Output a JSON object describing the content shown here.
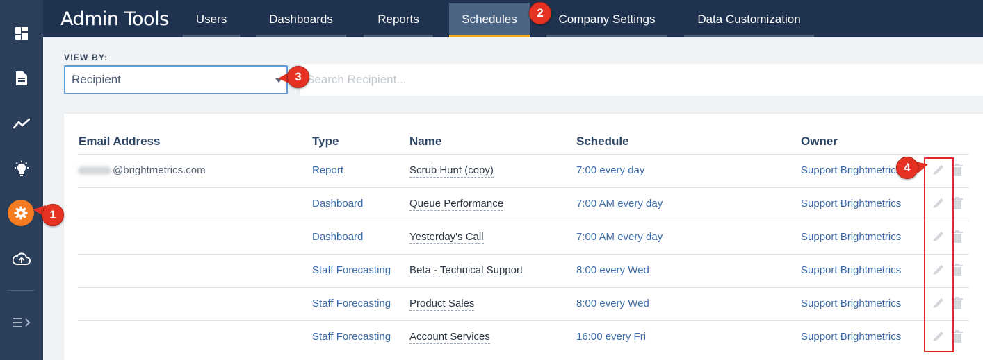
{
  "app_title": "Admin Tools",
  "tabs": [
    {
      "label": "Users"
    },
    {
      "label": "Dashboards"
    },
    {
      "label": "Reports"
    },
    {
      "label": "Schedules"
    },
    {
      "label": "Company Settings"
    },
    {
      "label": "Data Customization"
    }
  ],
  "active_tab": "Schedules",
  "sidebar": {
    "items": [
      {
        "icon": "dashboard-grid-icon"
      },
      {
        "icon": "document-icon"
      },
      {
        "icon": "trend-line-icon"
      },
      {
        "icon": "lightbulb-icon"
      },
      {
        "icon": "gear-icon"
      },
      {
        "icon": "cloud-upload-icon"
      },
      {
        "icon": "expand-menu-icon"
      }
    ]
  },
  "view_by": {
    "label": "VIEW BY:",
    "selected": "Recipient",
    "search_placeholder": "Search Recipient..."
  },
  "table": {
    "headers": {
      "email": "Email Address",
      "type": "Type",
      "name": "Name",
      "schedule": "Schedule",
      "owner": "Owner"
    },
    "rows": [
      {
        "email": "@brightmetrics.com",
        "type": "Report",
        "name": "Scrub Hunt (copy)",
        "schedule": "7:00 every day",
        "owner": "Support Brightmetrics"
      },
      {
        "email": "",
        "type": "Dashboard",
        "name": "Queue Performance",
        "schedule": "7:00 AM every day",
        "owner": "Support Brightmetrics"
      },
      {
        "email": "",
        "type": "Dashboard",
        "name": "Yesterday's Call",
        "schedule": "7:00 AM every day",
        "owner": "Support Brightmetrics"
      },
      {
        "email": "",
        "type": "Staff Forecasting",
        "name": "Beta - Technical Support",
        "schedule": "8:00 every Wed",
        "owner": "Support Brightmetrics"
      },
      {
        "email": "",
        "type": "Staff Forecasting",
        "name": "Product Sales",
        "schedule": "8:00 every Wed",
        "owner": "Support Brightmetrics"
      },
      {
        "email": "",
        "type": "Staff Forecasting",
        "name": "Account Services",
        "schedule": "16:00 every Fri",
        "owner": "Support Brightmetrics"
      }
    ]
  },
  "callouts": [
    "1",
    "2",
    "3",
    "4"
  ],
  "colors": {
    "sidebar": "#2b3f5b",
    "topbar": "#1f3350",
    "active_accent": "#f5a623",
    "active_icon_bg": "#f47b20",
    "callout": "#e53222",
    "link": "#3a6aa8"
  }
}
